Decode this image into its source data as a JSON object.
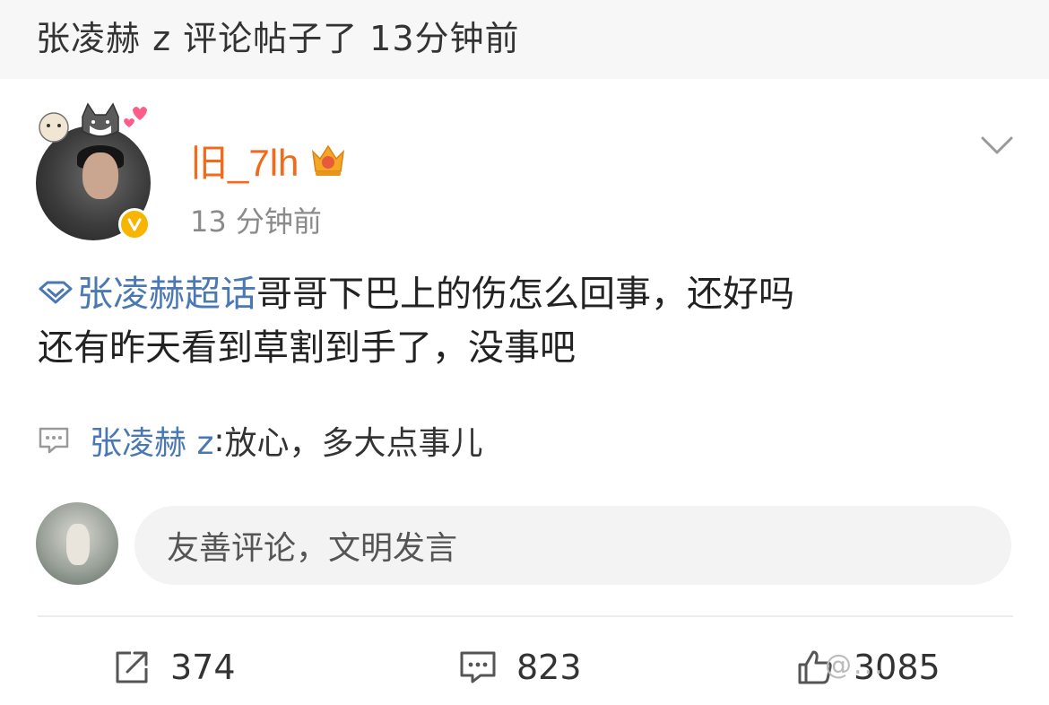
{
  "notice": {
    "text": "张凌赫 z 评论帖子了 13分钟前"
  },
  "post": {
    "username": "旧_7lh",
    "time": "13 分钟前",
    "topic": "张凌赫超话",
    "body_line1": "哥哥下巴上的伤怎么回事，还好吗",
    "body_line2": "还有昨天看到草割到手了，没事吧",
    "reply": {
      "author": "张凌赫 z",
      "separator": ": ",
      "text": "放心，多大点事儿"
    }
  },
  "composer": {
    "placeholder": "友善评论，文明发言"
  },
  "actions": {
    "repost_count": "374",
    "comment_count": "823",
    "like_count": "3085"
  },
  "watermark": {
    "text": "@..."
  },
  "icons": {
    "topic": "diamond-icon",
    "crown": "crown-icon",
    "verified": "verified-badge-icon",
    "menu": "chevron-down-icon",
    "comment": "comment-icon",
    "repost": "repost-icon",
    "like": "thumbs-up-icon"
  },
  "colors": {
    "username": "#f26a1b",
    "link": "#4a78b5",
    "verified": "#f7b500",
    "muted": "#8a8a8a"
  }
}
